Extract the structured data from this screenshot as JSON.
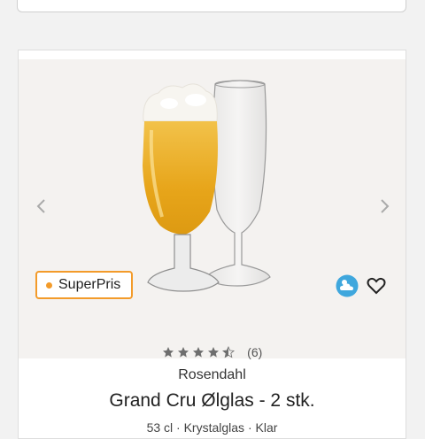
{
  "product": {
    "badge_label": "SuperPris",
    "rating_value": 4.5,
    "rating_max": 5,
    "review_count": "(6)",
    "brand": "Rosendahl",
    "title": "Grand Cru Ølglas - 2 stk.",
    "subtitle": "53 cl · Krystalglas · Klar"
  },
  "icons": {
    "search": "search-icon",
    "prev": "chevron-left-icon",
    "next": "chevron-right-icon",
    "weather": "cloud-sun-icon",
    "favorite": "heart-icon",
    "star": "star-icon"
  },
  "colors": {
    "badge_accent": "#f39b2a",
    "star": "#6e6e6e",
    "weather": "#3fa7dd"
  }
}
